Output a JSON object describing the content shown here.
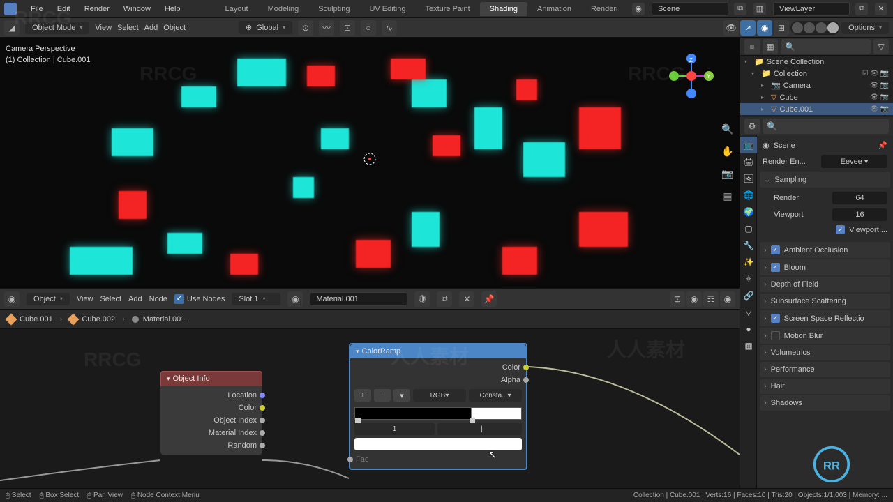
{
  "topmenu": {
    "file": "File",
    "edit": "Edit",
    "render": "Render",
    "window": "Window",
    "help": "Help"
  },
  "workspaces": {
    "layout": "Layout",
    "modeling": "Modeling",
    "sculpting": "Sculpting",
    "uv": "UV Editing",
    "tex": "Texture Paint",
    "shading": "Shading",
    "anim": "Animation",
    "render": "Renderi"
  },
  "topright": {
    "scene": "Scene",
    "viewlayer": "ViewLayer"
  },
  "toolbar": {
    "mode": "Object Mode",
    "view": "View",
    "select": "Select",
    "add": "Add",
    "object": "Object",
    "global": "Global",
    "options": "Options"
  },
  "overlay": {
    "line1": "Camera Perspective",
    "line2": "(1) Collection | Cube.001"
  },
  "nodehdr": {
    "object": "Object",
    "view": "View",
    "select": "Select",
    "add": "Add",
    "node": "Node",
    "use_nodes": "Use Nodes",
    "slot": "Slot 1",
    "material": "Material.001"
  },
  "breadcrumb": {
    "a": "Cube.001",
    "b": "Cube.002",
    "c": "Material.001"
  },
  "nodes": {
    "objinfo": {
      "title": "Object Info",
      "location": "Location",
      "color": "Color",
      "obj_index": "Object Index",
      "mat_index": "Material Index",
      "random": "Random"
    },
    "ramp": {
      "title": "ColorRamp",
      "out_color": "Color",
      "out_alpha": "Alpha",
      "mode": "RGB",
      "interp": "Consta...",
      "idx": "1",
      "pos": "|",
      "fac": "Fac"
    }
  },
  "outliner": {
    "root": "Scene Collection",
    "collection": "Collection",
    "camera": "Camera",
    "cube": "Cube",
    "cube001": "Cube.001"
  },
  "props": {
    "scene": "Scene",
    "render_engine_lbl": "Render En...",
    "render_engine": "Eevee",
    "sampling": "Sampling",
    "render_lbl": "Render",
    "render_val": "64",
    "viewport_lbl": "Viewport",
    "viewport_val": "16",
    "viewport_denoise": "Viewport ...",
    "ao": "Ambient Occlusion",
    "bloom": "Bloom",
    "dof": "Depth of Field",
    "sss": "Subsurface Scattering",
    "ssr": "Screen Space Reflectio",
    "motion_blur": "Motion Blur",
    "volumetrics": "Volumetrics",
    "performance": "Performance",
    "hair": "Hair",
    "shadows": "Shadows"
  },
  "status": {
    "select": "Select",
    "box": "Box Select",
    "pan": "Pan View",
    "context": "Node Context Menu",
    "right": "Collection | Cube.001 | Verts:16 | Faces:10 | Tris:20 | Objects:1/1,003 | Memory: ..."
  }
}
